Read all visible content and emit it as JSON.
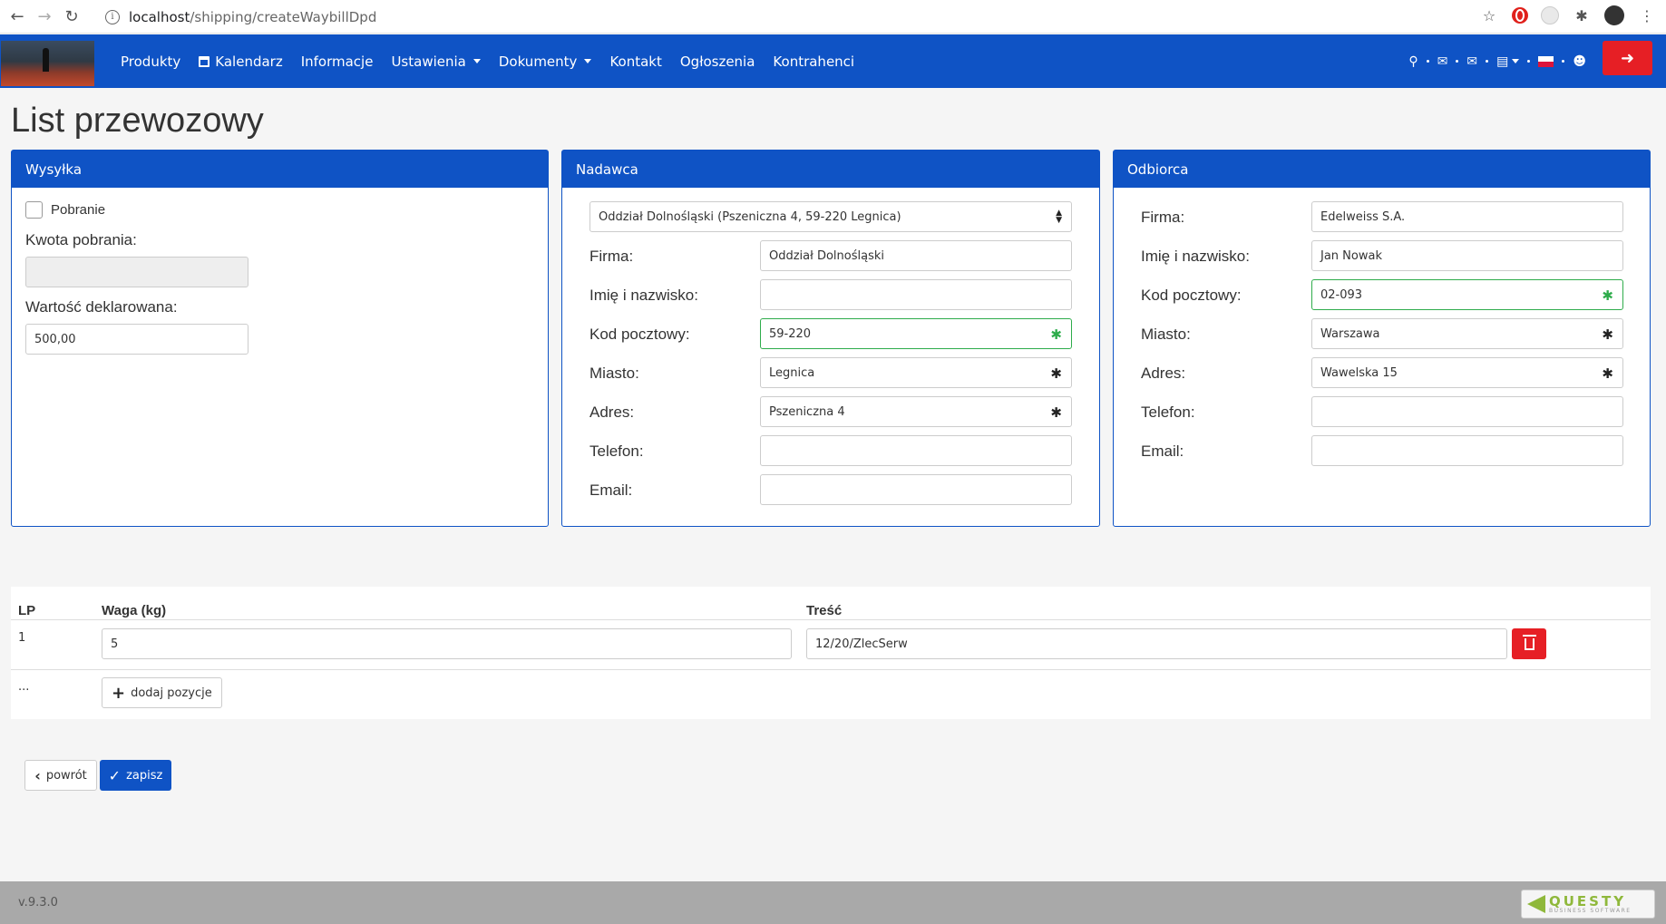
{
  "browser": {
    "url_host": "localhost",
    "url_path": "/shipping/createWaybillDpd"
  },
  "navbar": {
    "items": [
      {
        "label": "Produkty"
      },
      {
        "label": "Kalendarz"
      },
      {
        "label": "Informacje"
      },
      {
        "label": "Ustawienia"
      },
      {
        "label": "Dokumenty"
      },
      {
        "label": "Kontakt"
      },
      {
        "label": "Ogłoszenia"
      },
      {
        "label": "Kontrahenci"
      }
    ]
  },
  "page": {
    "title": "List przewozowy"
  },
  "shipment": {
    "header": "Wysyłka",
    "cod_label": "Pobranie",
    "cod_checked": false,
    "cod_amount_label": "Kwota pobrania:",
    "cod_amount_value": "",
    "declared_label": "Wartość deklarowana:",
    "declared_value": "500,00"
  },
  "sender": {
    "header": "Nadawca",
    "branch_selected": "Oddział Dolnośląski (Pszeniczna 4, 59-220 Legnica)",
    "fields": {
      "company_label": "Firma:",
      "company_value": "Oddział Dolnośląski",
      "name_label": "Imię i nazwisko:",
      "name_value": "",
      "postal_label": "Kod pocztowy:",
      "postal_value": "59-220",
      "city_label": "Miasto:",
      "city_value": "Legnica",
      "address_label": "Adres:",
      "address_value": "Pszeniczna 4",
      "phone_label": "Telefon:",
      "phone_value": "",
      "email_label": "Email:",
      "email_value": ""
    }
  },
  "recipient": {
    "header": "Odbiorca",
    "fields": {
      "company_label": "Firma:",
      "company_value": "Edelweiss S.A.",
      "name_label": "Imię i nazwisko:",
      "name_value": "Jan Nowak",
      "postal_label": "Kod pocztowy:",
      "postal_value": "02-093",
      "city_label": "Miasto:",
      "city_value": "Warszawa",
      "address_label": "Adres:",
      "address_value": "Wawelska 15",
      "phone_label": "Telefon:",
      "phone_value": "",
      "email_label": "Email:",
      "email_value": ""
    }
  },
  "parcels": {
    "columns": {
      "lp": "LP",
      "weight": "Waga (kg)",
      "content": "Treść"
    },
    "rows": [
      {
        "lp": "1",
        "weight": "5",
        "content": "12/20/ZlecSerw"
      }
    ],
    "new_row_lp": "...",
    "add_label": "dodaj pozycje"
  },
  "actions": {
    "back_label": "powrót",
    "save_label": "zapisz"
  },
  "footer": {
    "version": "v.9.3.0",
    "brand_name": "QUESTY",
    "brand_sub": "BUSINESS SOFTWARE"
  },
  "colors": {
    "primary": "#0f53c5",
    "danger": "#e61f25",
    "valid": "#2eac4b"
  }
}
